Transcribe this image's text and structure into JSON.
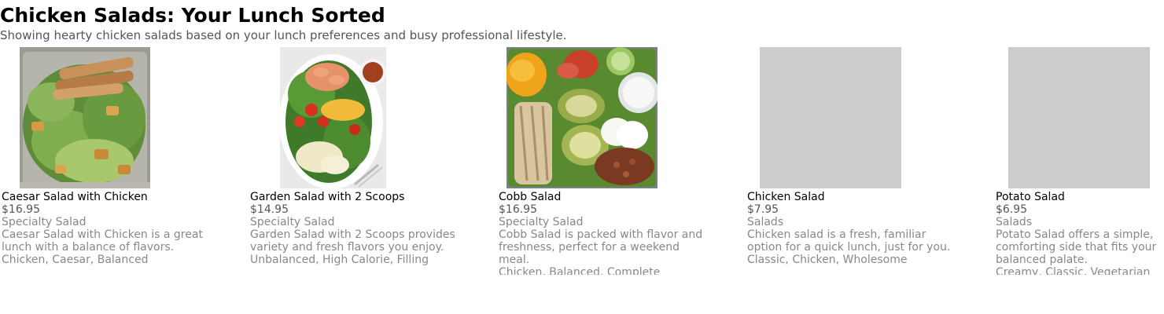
{
  "header": {
    "title": "Chicken Salads: Your Lunch Sorted",
    "subtitle": "Showing hearty chicken salads based on your lunch preferences and busy professional lifestyle."
  },
  "colors": {
    "title": "#000000",
    "muted": "#555555",
    "light": "#888888",
    "placeholder": "#cccccc"
  },
  "items": [
    {
      "name": "Caesar Salad with Chicken",
      "price": "$16.95",
      "category": "Specialty Salad",
      "description": "Caesar Salad with Chicken is a great lunch with a balance of flavors.",
      "tags": "Chicken, Caesar, Balanced",
      "image": "caesar-salad-photo"
    },
    {
      "name": "Garden Salad with 2 Scoops",
      "price": "$14.95",
      "category": "Specialty Salad",
      "description": "Garden Salad with 2 Scoops provides variety and fresh flavors you enjoy.",
      "tags": "Unbalanced, High Calorie, Filling",
      "image": "garden-salad-photo"
    },
    {
      "name": "Cobb Salad",
      "price": "$16.95",
      "category": "Specialty Salad",
      "description": "Cobb Salad is packed with flavor and freshness, perfect for a weekend meal.",
      "tags": "Chicken, Balanced, Complete",
      "image": "cobb-salad-photo"
    },
    {
      "name": "Chicken Salad",
      "price": "$7.95",
      "category": "Salads",
      "description": "Chicken salad is a fresh, familiar option for a quick lunch, just for you.",
      "tags": "Classic, Chicken, Wholesome",
      "image": "image-placeholder"
    },
    {
      "name": "Potato Salad",
      "price": "$6.95",
      "category": "Salads",
      "description": "Potato Salad offers a simple, comforting side that fits your balanced palate.",
      "tags": "Creamy, Classic, Vegetarian",
      "image": "image-placeholder"
    }
  ]
}
